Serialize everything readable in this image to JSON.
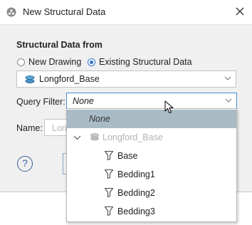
{
  "window": {
    "title": "New Structural Data",
    "close_icon": "close-icon"
  },
  "source": {
    "section_label": "Structural Data from",
    "options": [
      {
        "label": "New Drawing",
        "selected": false
      },
      {
        "label": "Existing Structural Data",
        "selected": true
      }
    ],
    "selected_value": "Longford_Base"
  },
  "query_filter": {
    "label": "Query Filter:",
    "value": "None"
  },
  "name_field": {
    "label": "Name:",
    "partial_value": "Lon"
  },
  "dropdown": {
    "items": [
      {
        "label": "None",
        "selected": true
      },
      {
        "label": "Longford_Base",
        "disabled": true
      },
      {
        "label": "Base"
      },
      {
        "label": "Bedding1"
      },
      {
        "label": "Bedding2"
      },
      {
        "label": "Bedding3"
      }
    ]
  },
  "help": {
    "label": "?"
  },
  "colors": {
    "accent": "#2f72c8",
    "selection": "#a9bcc6",
    "dialog_bg": "#f0f0f0"
  }
}
